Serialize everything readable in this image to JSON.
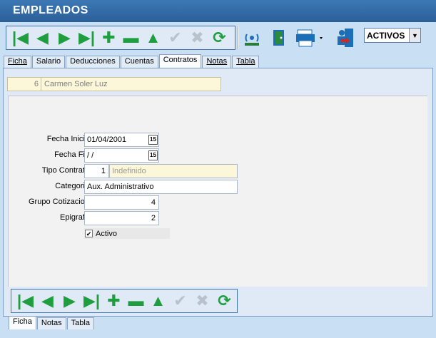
{
  "window": {
    "title": "EMPLEADOS"
  },
  "colors": {
    "title_bg": "#2f67a3",
    "nav_green": "#1f9e3f",
    "panel_bg": "#dfeaf6"
  },
  "toolbar": {
    "nav_icons": [
      "first-record-icon",
      "prior-record-icon",
      "next-record-icon",
      "last-record-icon",
      "insert-record-icon",
      "delete-record-icon",
      "edit-record-icon",
      "post-record-icon",
      "cancel-record-icon",
      "refresh-icon"
    ],
    "tools": [
      "antenna-icon",
      "exit-door-icon",
      "print-icon",
      "export-person-icon"
    ],
    "filter_value": "ACTIVOS"
  },
  "top_tabs": [
    {
      "label": "Ficha",
      "active": false
    },
    {
      "label": "Salario",
      "active": false
    },
    {
      "label": "Deducciones",
      "active": false
    },
    {
      "label": "Cuentas",
      "active": false
    },
    {
      "label": "Contratos",
      "active": true
    },
    {
      "label": "Notas",
      "active": false
    },
    {
      "label": "Tabla",
      "active": false
    }
  ],
  "employee": {
    "number": "6",
    "name": "Carmen Soler Luz"
  },
  "form": {
    "fecha_inicio": {
      "label": "Fecha Inicio",
      "value": "01/04/2001"
    },
    "fecha_fin": {
      "label": "Fecha Fin",
      "value": " /  /"
    },
    "tipo_contrato": {
      "label": "Tipo Contrato",
      "code": "1",
      "description": "Indefinido"
    },
    "categoria": {
      "label": "Categoria",
      "value": "Aux. Administrativo"
    },
    "grupo_cotizacion": {
      "label": "Grupo Cotizacion",
      "value": "4"
    },
    "epigrafe": {
      "label": "Epigrafe",
      "value": "2"
    },
    "activo": {
      "label": "Activo",
      "checked": true
    }
  },
  "calendar_glyph": "15",
  "bottom_tabs": [
    {
      "label": "Ficha",
      "active": true
    },
    {
      "label": "Notas",
      "active": false
    },
    {
      "label": "Tabla",
      "active": false
    }
  ]
}
